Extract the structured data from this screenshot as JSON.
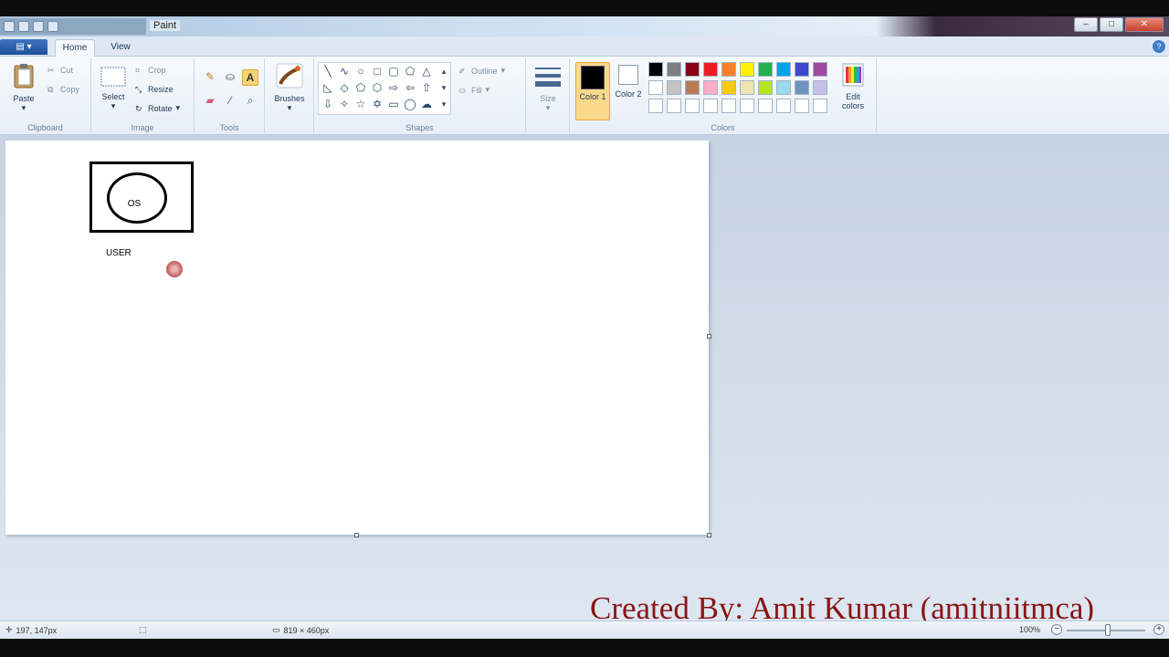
{
  "window": {
    "title": "Paint",
    "min": "–",
    "max": "□",
    "close": "✕"
  },
  "tabs": [
    {
      "label": "Home",
      "active": true
    },
    {
      "label": "View",
      "active": false
    }
  ],
  "ribbon": {
    "clipboard": {
      "label": "Clipboard",
      "paste": "Paste",
      "cut": "Cut",
      "copy": "Copy"
    },
    "image": {
      "label": "Image",
      "select": "Select",
      "crop": "Crop",
      "resize": "Resize",
      "rotate": "Rotate"
    },
    "tools": {
      "label": "Tools"
    },
    "brushes": {
      "label": "Brushes"
    },
    "shapes": {
      "label": "Shapes",
      "outline": "Outline",
      "fill": "Fill"
    },
    "size": {
      "label": "Size"
    },
    "colors": {
      "label": "Colors",
      "color1": "Color 1",
      "color2": "Color 2",
      "edit": "Edit colors",
      "color1_value": "#000000",
      "color2_value": "#ffffff",
      "palette_row1": [
        "#000000",
        "#7f7f7f",
        "#880015",
        "#ed1c24",
        "#ff7f27",
        "#fff200",
        "#22b14c",
        "#00a2e8",
        "#3f48cc",
        "#a349a4"
      ],
      "palette_row2": [
        "#ffffff",
        "#c3c3c3",
        "#b97a57",
        "#ffaec9",
        "#ffc90e",
        "#efe4b0",
        "#b5e61d",
        "#99d9ea",
        "#7092be",
        "#c8bfe7"
      ],
      "palette_row3": [
        "#ffffff",
        "#ffffff",
        "#ffffff",
        "#ffffff",
        "#ffffff",
        "#ffffff",
        "#ffffff",
        "#ffffff",
        "#ffffff",
        "#ffffff"
      ]
    }
  },
  "canvas": {
    "labels": {
      "os": "OS",
      "user": "USER"
    }
  },
  "watermark": "Created By: Amit Kumar (amitniitmca)",
  "status": {
    "cursor": "197, 147px",
    "image_size": "819 × 460px",
    "zoom": "100%"
  }
}
